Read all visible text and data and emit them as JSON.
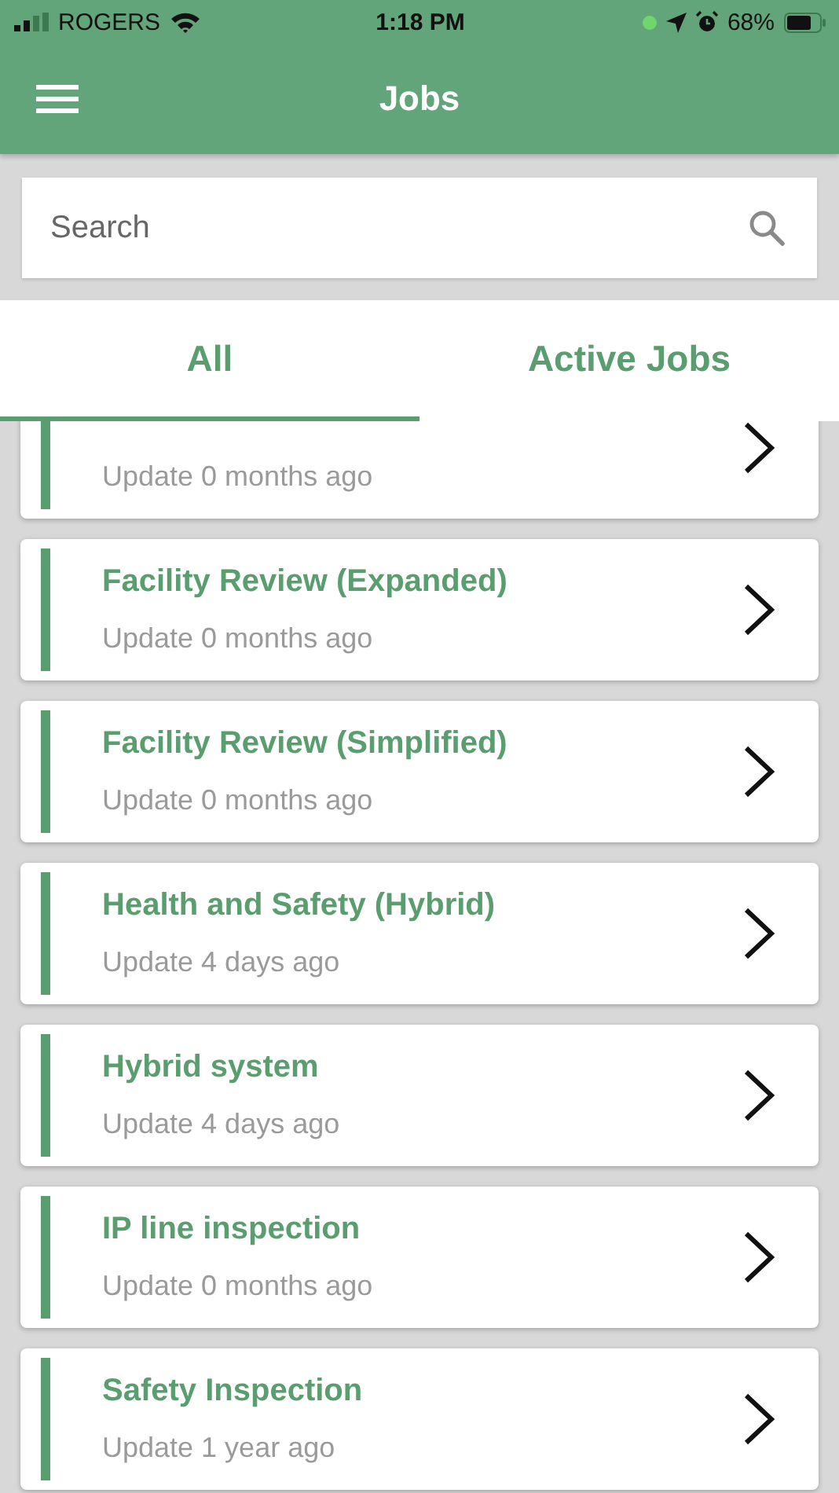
{
  "status_bar": {
    "carrier": "ROGERS",
    "time": "1:18 PM",
    "battery": "68%"
  },
  "header": {
    "title": "Jobs"
  },
  "search": {
    "placeholder": "Search"
  },
  "tabs": [
    {
      "label": "All",
      "selected": true
    },
    {
      "label": "Active Jobs",
      "selected": false
    }
  ],
  "jobs": [
    {
      "updated": "Update 0 months ago"
    },
    {
      "title": "Facility Review (Expanded)",
      "updated": "Update 0 months ago"
    },
    {
      "title": "Facility Review (Simplified)",
      "updated": "Update 0 months ago"
    },
    {
      "title": "Health and Safety (Hybrid)",
      "updated": "Update 4 days ago"
    },
    {
      "title": "Hybrid system",
      "updated": "Update 4 days ago"
    },
    {
      "title": "IP line inspection",
      "updated": "Update 0 months ago"
    },
    {
      "title": "Safety Inspection",
      "updated": "Update 1 year ago"
    }
  ]
}
